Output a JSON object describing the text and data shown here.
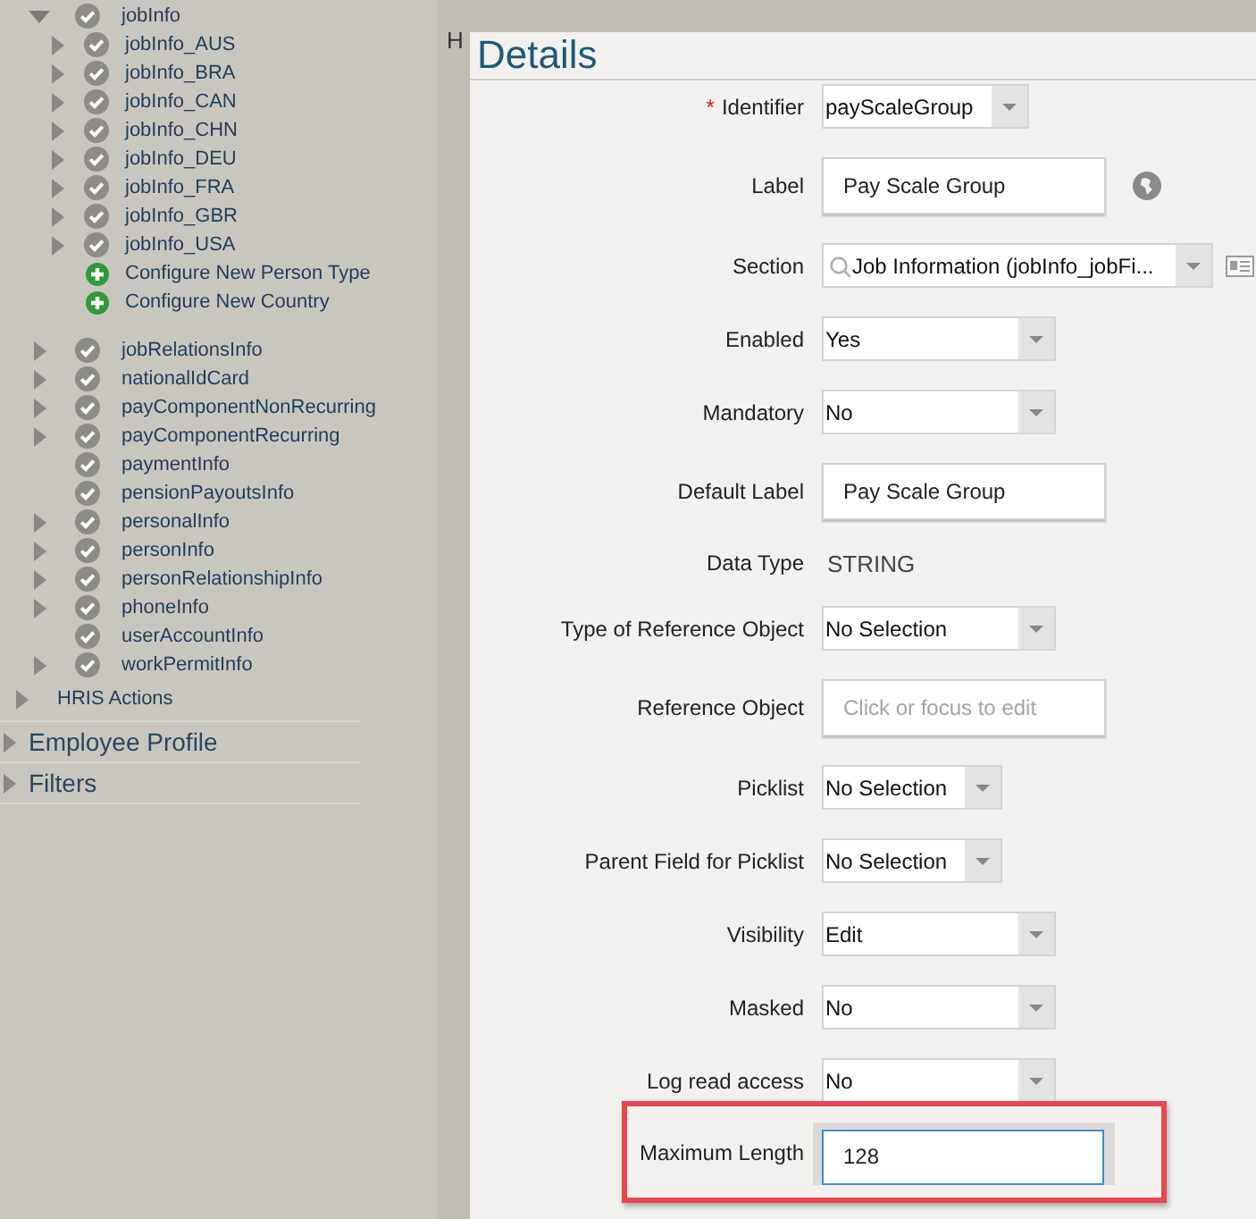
{
  "sidebar": {
    "items": [
      {
        "label": "jobInfo",
        "kind": "folder",
        "expanded": true,
        "children": [
          {
            "label": "jobInfo_AUS",
            "kind": "folder",
            "expanded": false
          },
          {
            "label": "jobInfo_BRA",
            "kind": "folder",
            "expanded": false
          },
          {
            "label": "jobInfo_CAN",
            "kind": "folder",
            "expanded": false
          },
          {
            "label": "jobInfo_CHN",
            "kind": "folder",
            "expanded": false
          },
          {
            "label": "jobInfo_DEU",
            "kind": "folder",
            "expanded": false
          },
          {
            "label": "jobInfo_FRA",
            "kind": "folder",
            "expanded": false
          },
          {
            "label": "jobInfo_GBR",
            "kind": "folder",
            "expanded": false
          },
          {
            "label": "jobInfo_USA",
            "kind": "folder",
            "expanded": false
          },
          {
            "label": "Configure New Person Type",
            "kind": "action"
          },
          {
            "label": "Configure New Country",
            "kind": "action"
          }
        ]
      },
      {
        "label": "jobRelationsInfo",
        "kind": "folder",
        "expanded": false
      },
      {
        "label": "nationalIdCard",
        "kind": "folder",
        "expanded": false
      },
      {
        "label": "payComponentNonRecurring",
        "kind": "folder",
        "expanded": false
      },
      {
        "label": "payComponentRecurring",
        "kind": "folder",
        "expanded": false
      },
      {
        "label": "paymentInfo",
        "kind": "leaf"
      },
      {
        "label": "pensionPayoutsInfo",
        "kind": "leaf"
      },
      {
        "label": "personalInfo",
        "kind": "folder",
        "expanded": false
      },
      {
        "label": "personInfo",
        "kind": "folder",
        "expanded": false
      },
      {
        "label": "personRelationshipInfo",
        "kind": "folder",
        "expanded": false
      },
      {
        "label": "phoneInfo",
        "kind": "folder",
        "expanded": false
      },
      {
        "label": "userAccountInfo",
        "kind": "leaf"
      },
      {
        "label": "workPermitInfo",
        "kind": "folder",
        "expanded": false
      }
    ],
    "groups": [
      {
        "label": "HRIS Actions",
        "expanded": false
      }
    ],
    "sections": [
      {
        "label": "Employee Profile",
        "expanded": false
      },
      {
        "label": "Filters",
        "expanded": false
      }
    ]
  },
  "background_title": "H",
  "details": {
    "title": "Details",
    "rows": [
      {
        "marker": "*",
        "label": "Identifier",
        "kind": "select",
        "value": "payScaleGroup",
        "highlighted": false
      },
      {
        "label": "Label",
        "kind": "textbox",
        "value": "Pay Scale Group",
        "focused": false,
        "highlighted": false
      },
      {
        "label": "Section",
        "kind": "select",
        "value": "Job Information (jobInfo_jobFi...",
        "highlighted": false
      },
      {
        "label": "Enabled",
        "kind": "select",
        "value": "Yes",
        "highlighted": false
      },
      {
        "label": "Mandatory",
        "kind": "select",
        "value": "No",
        "highlighted": false
      },
      {
        "label": "Default Label",
        "kind": "textbox",
        "value": "Pay Scale Group",
        "focused": false,
        "highlighted": false
      },
      {
        "label": "Data Type",
        "kind": "text",
        "value": "STRING",
        "highlighted": false
      },
      {
        "label": "Type of Reference Object",
        "kind": "select",
        "value": "No Selection",
        "highlighted": false
      },
      {
        "label": "Reference Object",
        "kind": "textbox",
        "placeholder": "Click or focus to edit",
        "focused": false,
        "highlighted": false
      },
      {
        "label": "Picklist",
        "kind": "select",
        "value": "No Selection",
        "highlighted": false
      },
      {
        "label": "Parent Field for Picklist",
        "kind": "select",
        "value": "No Selection",
        "highlighted": false
      },
      {
        "label": "Visibility",
        "kind": "select",
        "value": "Edit",
        "highlighted": false
      },
      {
        "label": "Masked",
        "kind": "select",
        "value": "No",
        "highlighted": false
      },
      {
        "label": "Log read access",
        "kind": "select",
        "value": "No",
        "highlighted": false
      },
      {
        "label": "Maximum Length",
        "kind": "textbox",
        "value": "128",
        "focused": true,
        "highlighted": true
      }
    ]
  }
}
